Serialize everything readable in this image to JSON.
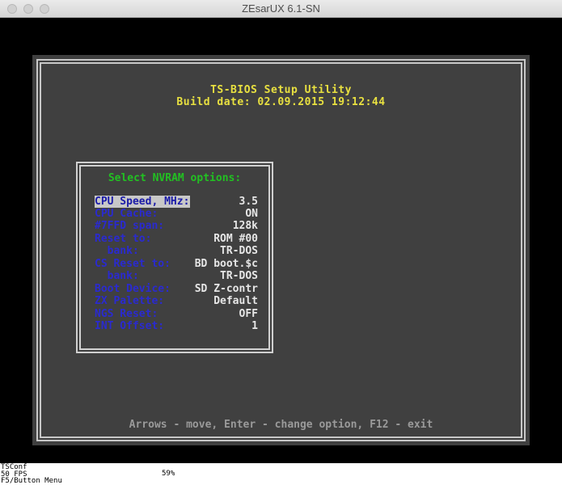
{
  "window": {
    "title": "ZEsarUX 6.1-SN"
  },
  "bios": {
    "title": "TS-BIOS Setup Utility",
    "build_date": "Build date: 02.09.2015 19:12:44",
    "panel_title": "Select NVRAM options:",
    "options": [
      {
        "label": "CPU Speed, MHz:",
        "value": "3.5",
        "selected": true
      },
      {
        "label": "CPU Cache:",
        "value": "ON"
      },
      {
        "label": "#7FFD span:",
        "value": "128k"
      },
      {
        "label": "Reset to:",
        "value": "ROM #00"
      },
      {
        "label": "  bank:",
        "value": "TR-DOS"
      },
      {
        "label": "CS Reset to:",
        "value": "BD boot.$c"
      },
      {
        "label": "  bank:",
        "value": "TR-DOS"
      },
      {
        "label": "Boot Device:",
        "value": "SD Z-contr"
      },
      {
        "label": "ZX Palette:",
        "value": "Default"
      },
      {
        "label": "NGS Reset:",
        "value": "OFF"
      },
      {
        "label": "INT Offset:",
        "value": "1"
      }
    ],
    "footer": "Arrows - move,  Enter - change option,  F12 - exit"
  },
  "status": {
    "machine": "TSConf",
    "fps": "50 FPS",
    "percent": "59%",
    "menu_hint": "F5/Button Menu"
  },
  "colors": {
    "header_yellow": "#e8e040",
    "panel_title_green": "#22c022",
    "option_label_blue": "#2a2ad0",
    "option_value_white": "#e6e6e6",
    "footer_gray": "#9a9a9a",
    "bios_background": "#404040"
  }
}
